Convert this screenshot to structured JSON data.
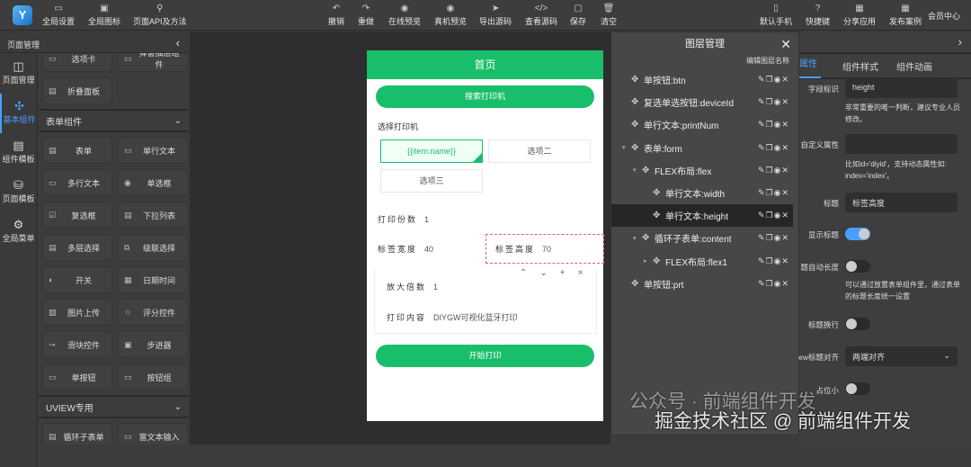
{
  "toolbar": {
    "left": [
      {
        "label": "全局设置",
        "icon": "settings-icon"
      },
      {
        "label": "全局图标",
        "icon": "image-icon"
      },
      {
        "label": "页面API及方法",
        "icon": "link-icon"
      }
    ],
    "center": [
      {
        "label": "撤销",
        "icon": "undo-icon"
      },
      {
        "label": "重做",
        "icon": "redo-icon"
      },
      {
        "label": "在线预览",
        "icon": "eye-icon"
      },
      {
        "label": "真机预览",
        "icon": "eye-icon"
      },
      {
        "label": "导出源码",
        "icon": "send-icon"
      },
      {
        "label": "查看源码",
        "icon": "code-icon"
      },
      {
        "label": "保存",
        "icon": "save-icon"
      },
      {
        "label": "清空",
        "icon": "trash-icon"
      }
    ],
    "right": [
      {
        "label": "默认手机",
        "icon": "phone-icon"
      },
      {
        "label": "快捷键",
        "icon": "help-icon"
      },
      {
        "label": "分享应用",
        "icon": "qr-icon"
      },
      {
        "label": "发布案例",
        "icon": "qr-icon"
      }
    ],
    "member": "会员中心"
  },
  "rail": [
    {
      "label": "页面管理"
    },
    {
      "label": "基本组件"
    },
    {
      "label": "组件模板"
    },
    {
      "label": "页面模板"
    },
    {
      "label": "全局菜单"
    }
  ],
  "panel": {
    "title": "页面管理",
    "top_items": [
      "选项卡",
      "弹窗抽层组件",
      "折叠面板"
    ],
    "form_section": "表单组件",
    "form_items": [
      "表单",
      "单行文本",
      "多行文本",
      "单选框",
      "复选框",
      "下拉列表",
      "多层选择",
      "级联选择",
      "开关",
      "日期时间",
      "图片上传",
      "评分控件",
      "滑块控件",
      "步进器",
      "单按钮",
      "按钮组"
    ],
    "uview_section": "UVIEW专用",
    "uview_items": [
      "循环子表单",
      "富文本输入"
    ]
  },
  "phone": {
    "title": "首页",
    "search_btn": "搜索打印机",
    "select_label": "选择打印机",
    "options": [
      "{{item.name}}",
      "选项二",
      "选项三"
    ],
    "copies_label": "打印份数",
    "copies": "1",
    "width_label": "标签宽度",
    "width": "40",
    "height_label": "标签高度",
    "height": "70",
    "zoom_label": "放大倍数",
    "zoom": "1",
    "content_label": "打印内容",
    "content": "DIYGW可视化蓝牙打印",
    "print_btn": "开始打印"
  },
  "layers": {
    "title": "图层管理",
    "subtitle": "编辑图层名称",
    "items": [
      {
        "label": "单按钮:btn"
      },
      {
        "label": "复选单选按钮:deviceId"
      },
      {
        "label": "单行文本:printNum"
      },
      {
        "label": "表单:form"
      },
      {
        "label": "FLEX布局:flex"
      },
      {
        "label": "单行文本:width"
      },
      {
        "label": "单行文本:height"
      },
      {
        "label": "循环子表单:content"
      },
      {
        "label": "FLEX布局:flex1"
      },
      {
        "label": "单按钮:prt"
      }
    ]
  },
  "props": {
    "tabs": [
      "属性",
      "组件样式",
      "组件动画"
    ],
    "field_id_label": "字段标识",
    "field_id": "height",
    "field_id_hint": "非常重要的唯一判断，建议专业人员修改。",
    "custom_attr_label": "自定义属性",
    "custom_attr": "",
    "custom_attr_hint": "比如id='diyid'，支持动态属性如: index='index'。",
    "title_label": "标题",
    "title": "标签高度",
    "show_title_label": "显示标题",
    "show_title": true,
    "auto_len_label": "题自动长度",
    "auto_len": false,
    "auto_len_hint": "可以通过放置表单组件里，通过表单的标题长度统一设置",
    "wrap_label": "标题换行",
    "wrap": false,
    "align_label": "ew标题对齐",
    "align": "两端对齐",
    "placeholder_label": "占位小",
    "placeholder": false
  },
  "watermark": {
    "line1": "公众号 · 前端组件开发",
    "line2": "掘金技术社区 @ 前端组件开发"
  }
}
